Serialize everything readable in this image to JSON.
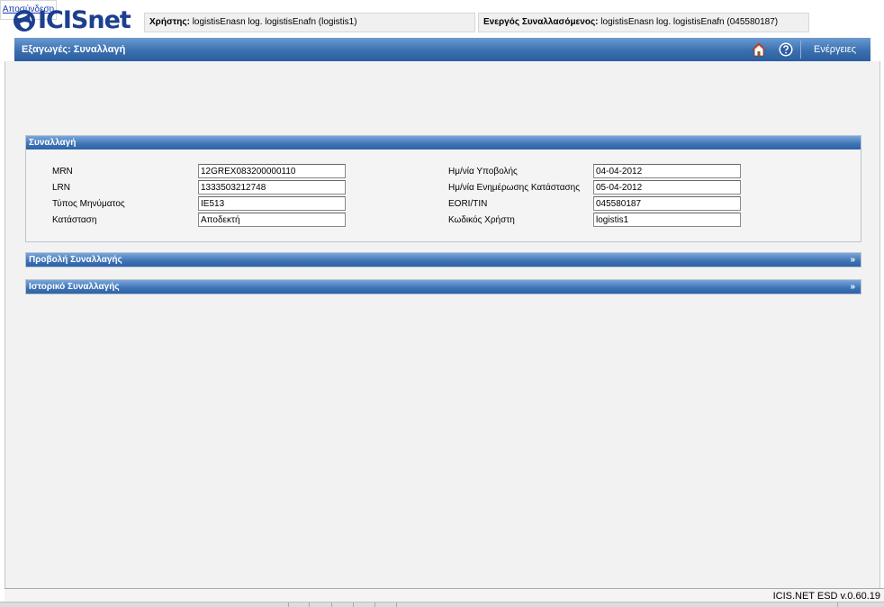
{
  "app": {
    "logo_text": "ICISnet"
  },
  "header": {
    "user_label": "Χρήστης:",
    "user_value": "logistisEnasn log. logistisEnafn (logistis1)",
    "trader_label": "Ενεργός Συναλλασόμενος:",
    "trader_value": "logistisEnasn log. logistisEnafn (045580187)",
    "logout_label": "Αποσύνδεση"
  },
  "titlebar": {
    "title": "Εξαγωγές: Συναλλαγή",
    "actions_label": "Ενέργειες"
  },
  "transaction_panel": {
    "title": "Συναλλαγή",
    "fields_left": [
      {
        "label": "MRN",
        "value": "12GREX083200000110"
      },
      {
        "label": "LRN",
        "value": "1333503212748"
      },
      {
        "label": "Τύπος Μηνύματος",
        "value": "IE513"
      },
      {
        "label": "Κατάσταση",
        "value": "Αποδεκτή"
      }
    ],
    "fields_right": [
      {
        "label": "Ημ/νία Υποβολής",
        "value": "04-04-2012"
      },
      {
        "label": "Ημ/νία Ενημέρωσης Κατάστασης",
        "value": "05-04-2012"
      },
      {
        "label": "EORI/TIN",
        "value": "045580187"
      },
      {
        "label": "Κωδικός Χρήστη",
        "value": "logistis1"
      }
    ]
  },
  "view_panel": {
    "title": "Προβολή Συναλλαγής",
    "chevron": "»"
  },
  "history_panel": {
    "title": "Ιστορικό Συναλλαγής",
    "chevron": "»"
  },
  "footer": {
    "version": "ICIS.NET ESD v.0.60.19"
  },
  "colors": {
    "brand": "#1c3f8f",
    "titlebar": "#3a6fb0",
    "panel_header": "#3d72b4",
    "content_bg": "#f2f2f2",
    "link": "#1a3bb5"
  },
  "icons": {
    "logo": "globe-icon",
    "home": "home-icon",
    "help": "help-icon"
  }
}
